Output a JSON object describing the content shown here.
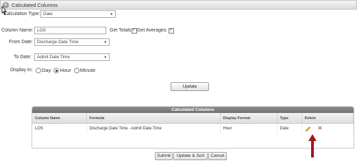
{
  "panel": {
    "title": "Calculated Columns",
    "collapse_glyph": "▾"
  },
  "form": {
    "calculation_type": {
      "label": "Calculation Type:",
      "value": "Date"
    },
    "column_name": {
      "label": "Column Name:",
      "value": "LOS"
    },
    "get_totals": {
      "label": "Get Totals:",
      "checked": true
    },
    "get_averages": {
      "label": "Get Averages:",
      "checked": true
    },
    "from_date": {
      "label": "From Date:",
      "value": "Discharge Date Time"
    },
    "to_date": {
      "label": "To Date:",
      "value": "Admit Date Time"
    },
    "display_in": {
      "label": "Display In:",
      "options": [
        {
          "label": "Day",
          "checked": false
        },
        {
          "label": "Hour",
          "checked": true
        },
        {
          "label": "Minute",
          "checked": false
        }
      ]
    },
    "update_label": "Update"
  },
  "grid": {
    "title": "Calculated Columns",
    "columns": [
      "Column Name",
      "Formula",
      "Display Format",
      "Type",
      "Delete"
    ],
    "rows": [
      {
        "column_name": "LOS",
        "formula": "Discharge Date Time - Admit Date Time",
        "display_format": "Hour",
        "type": "Date"
      }
    ]
  },
  "footer": {
    "submit_label": "Submit",
    "update_sort_label": "Update & Sort",
    "cancel_label": "Cancel"
  },
  "icons": {
    "edit": "pencil-icon",
    "delete": "close-icon",
    "annotation": "arrow-up-icon"
  },
  "colors": {
    "grid_header": "#7a7a7a",
    "delete": "#c0392b",
    "annotation_arrow": "#a01818",
    "edit_pencil": "#d9a92b"
  }
}
